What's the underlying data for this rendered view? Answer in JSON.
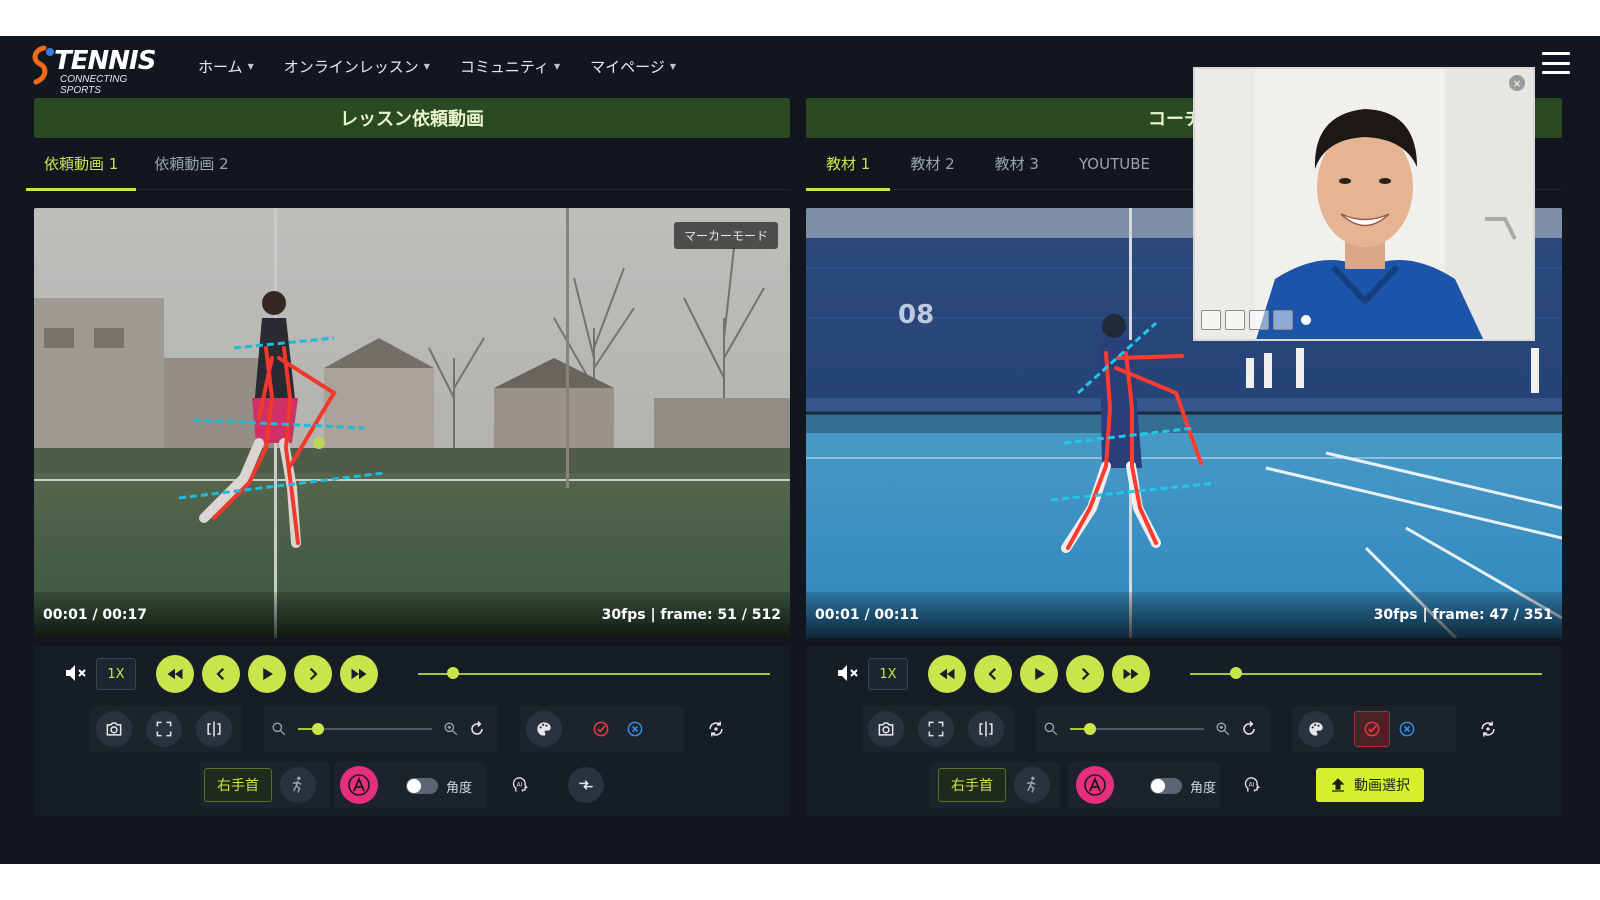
{
  "nav": {
    "logo_text": "TENNIS",
    "logo_sub": "CONNECTING SPORTS",
    "items": [
      {
        "label": "ホーム"
      },
      {
        "label": "オンラインレッスン"
      },
      {
        "label": "コミュニティ"
      },
      {
        "label": "マイページ"
      }
    ]
  },
  "left": {
    "title": "レッスン依頼動画",
    "tabs": [
      "依頼動画 1",
      "依頼動画 2"
    ],
    "marker_mode": "マーカーモード",
    "time": "00:01 / 00:17",
    "fps": "30fps | frame: 51 / 512",
    "speed": "1X",
    "wrist_label": "右手首",
    "angle_label": "角度",
    "playback_progress": 0.1,
    "zoom_level": 0.15
  },
  "right": {
    "title": "コーチ教",
    "tabs": [
      "教材 1",
      "教材 2",
      "教材 3",
      "YOUTUBE"
    ],
    "time": "00:01 / 00:11",
    "fps": "30fps | frame: 47 / 351",
    "speed": "1X",
    "wrist_label": "右手首",
    "angle_label": "角度",
    "select_label": "動画選択",
    "playback_progress": 0.13,
    "zoom_level": 0.15
  },
  "pip": {
    "close": "×"
  },
  "colors": {
    "accent": "#c8e64c",
    "header_green": "#2a4a22",
    "pink": "#e62e7e",
    "background": "#12171f"
  }
}
